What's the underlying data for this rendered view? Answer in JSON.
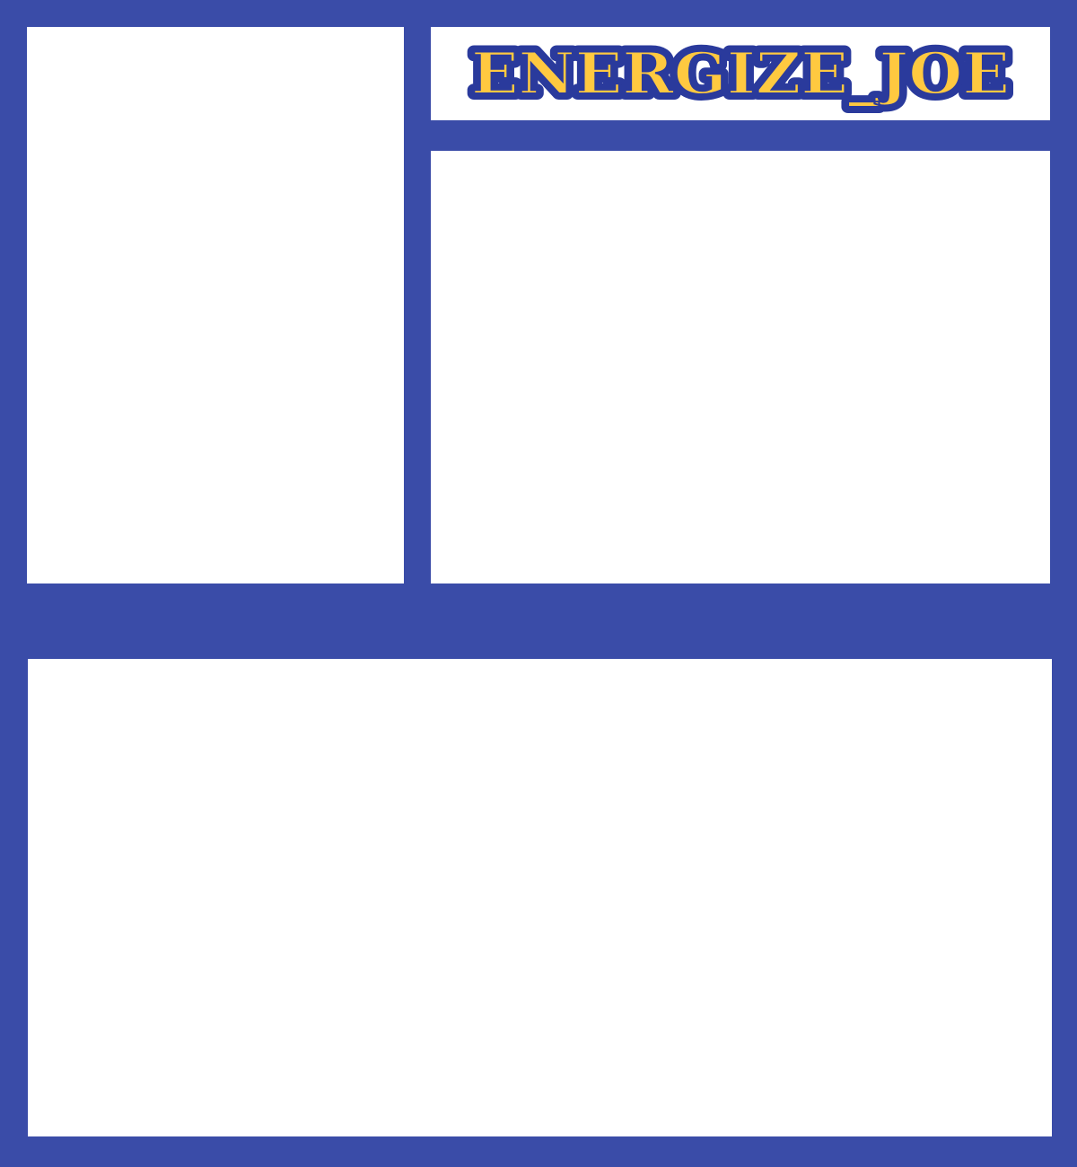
{
  "title": {
    "text": "ENERGIZE_JOE"
  },
  "colors": {
    "frame": "#3a4ca8",
    "panel": "#ffffff",
    "title_fill": "#ffc940",
    "title_outline": "#2a3a9c"
  }
}
